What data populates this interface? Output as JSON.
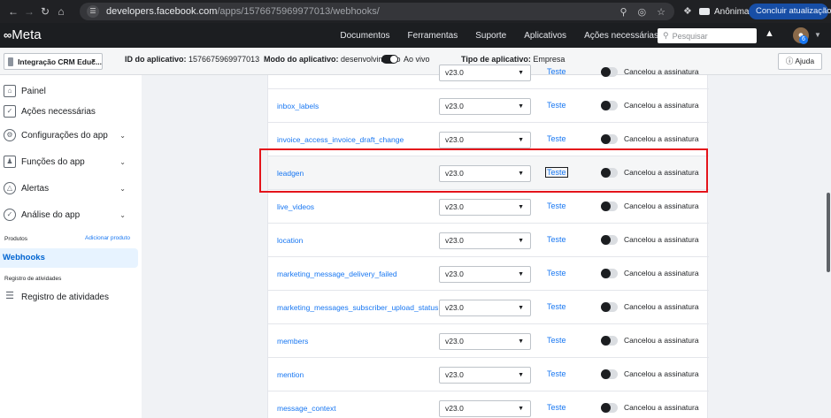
{
  "browser": {
    "url_host": "developers.facebook.com",
    "url_path": "/apps/1576675969977013/webhooks/",
    "incognito_label": "Anônima",
    "update_button": "Concluir atualização"
  },
  "topnav": {
    "logo": "Meta",
    "menu": [
      "Documentos",
      "Ferramentas",
      "Suporte",
      "Aplicativos",
      "Ações necessárias"
    ],
    "search_placeholder": "Pesquisar",
    "avatar_badge": "6"
  },
  "infobar": {
    "app_name": "Integração CRM Educ...",
    "app_id_label": "ID do aplicativo:",
    "app_id": "1576675969977013",
    "mode_label": "Modo do aplicativo:",
    "mode_value": "desenvolvimento",
    "live_label": "Ao vivo",
    "type_label": "Tipo de aplicativo:",
    "type_value": "Empresa",
    "help": "Ajuda"
  },
  "sidebar": {
    "items": [
      {
        "label": "Painel",
        "icon": "home-icon",
        "chevron": false
      },
      {
        "label": "Ações necessárias",
        "icon": "checklist-icon",
        "chevron": false
      },
      {
        "label": "Configurações do app",
        "icon": "gear-icon",
        "chevron": true
      },
      {
        "label": "Funções do app",
        "icon": "users-icon",
        "chevron": true
      },
      {
        "label": "Alertas",
        "icon": "bell-icon",
        "chevron": true
      },
      {
        "label": "Análise do app",
        "icon": "check-circle-icon",
        "chevron": true
      }
    ],
    "products_label": "Produtos",
    "add_product": "Adicionar produto",
    "active_item": "Webhooks",
    "activity_section": "Registro de atividades",
    "activity_item": "Registro de atividades"
  },
  "webhooks": {
    "version_default": "v23.0",
    "test_label": "Teste",
    "subscription_label": "Cancelou a assinatura",
    "rows": [
      {
        "field": "",
        "partial": true
      },
      {
        "field": "inbox_labels"
      },
      {
        "field": "invoice_access_invoice_draft_change"
      },
      {
        "field": "leadgen",
        "highlighted": true
      },
      {
        "field": "live_videos"
      },
      {
        "field": "location"
      },
      {
        "field": "marketing_message_delivery_failed"
      },
      {
        "field": "marketing_messages_subscriber_upload_status"
      },
      {
        "field": "members"
      },
      {
        "field": "mention"
      },
      {
        "field": "message_context"
      }
    ]
  },
  "colors": {
    "link": "#1877f2",
    "highlight_border": "#e4141b",
    "topnav_bg": "#1c1e21"
  }
}
